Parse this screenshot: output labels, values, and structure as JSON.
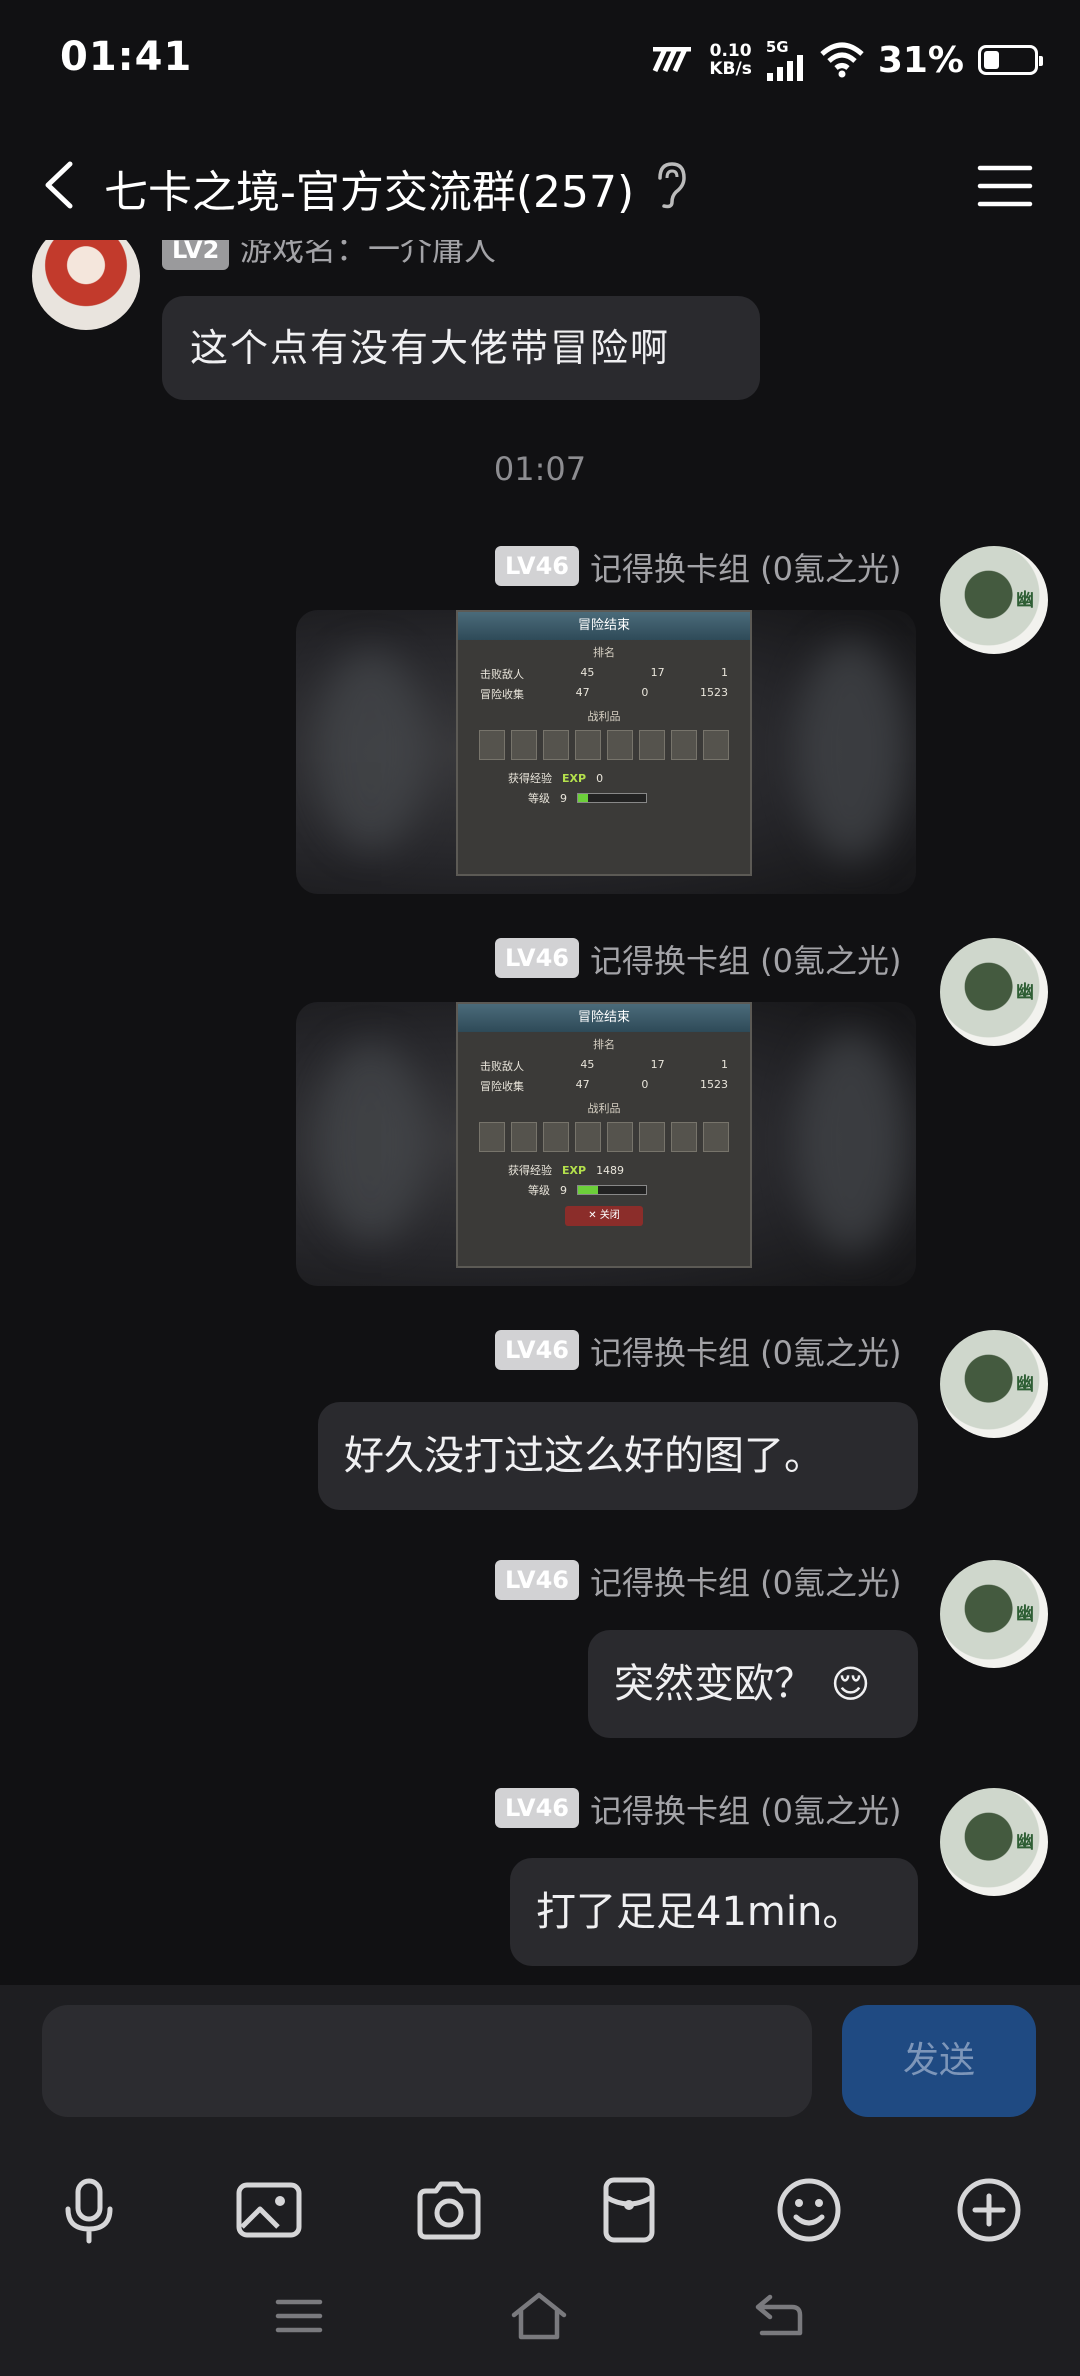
{
  "status_bar": {
    "time": "01:41",
    "speed_value": "0.10",
    "speed_unit": "KB/s",
    "network": "5G",
    "battery_percent": "31%",
    "battery_level": 0.31
  },
  "header": {
    "title": "七卡之境-官方交流群(257)"
  },
  "messages": {
    "m0": {
      "level": "LV2",
      "nick": "游戏名：一介庸人",
      "text": "这个点有没有大佬带冒险啊"
    },
    "divider_time": "01:07",
    "sender": {
      "level": "LV46",
      "nick": "记得换卡组 (0氪之光)"
    },
    "img1": {
      "title": "冒险结束",
      "rank_label": "排名",
      "defeat_label": "击败敌人",
      "collect_label": "冒险收集",
      "defeat_a": "45",
      "defeat_b": "17",
      "defeat_c": "1",
      "collect_a": "47",
      "collect_b": "0",
      "collect_c": "1523",
      "loot_label": "战利品",
      "exp_label": "获得经验",
      "exp_value": "0",
      "level_label": "等级",
      "level_value": "9",
      "exp_fill": 0.15
    },
    "img2": {
      "title": "冒险结束",
      "rank_label": "排名",
      "defeat_label": "击败敌人",
      "collect_label": "冒险收集",
      "defeat_a": "45",
      "defeat_b": "17",
      "defeat_c": "1",
      "collect_a": "47",
      "collect_b": "0",
      "collect_c": "1523",
      "loot_label": "战利品",
      "exp_label": "获得经验",
      "exp_value": "1489",
      "level_label": "等级",
      "level_value": "9",
      "close_label": "关闭",
      "exp_fill": 0.3
    },
    "m3": {
      "text": "好久没打过这么好的图了。"
    },
    "m4": {
      "text": "突然变欧？",
      "emoji": "😌"
    },
    "m5": {
      "text": "打了足足41min。"
    }
  },
  "composer": {
    "placeholder": "",
    "send_label": "发送"
  },
  "exp_tag": "EXP"
}
